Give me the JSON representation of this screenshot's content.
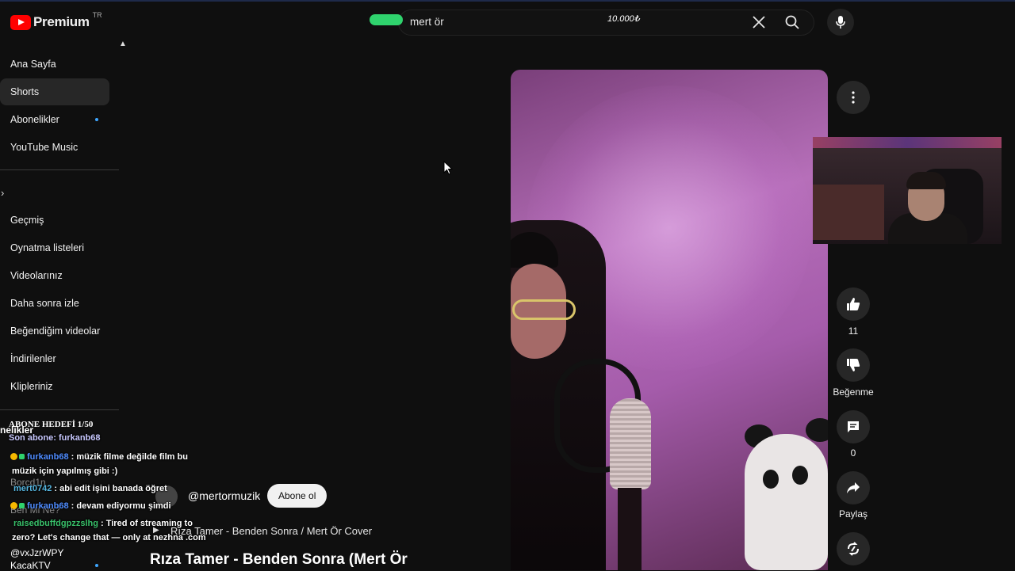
{
  "header": {
    "logo_text": "Premium",
    "country_code": "TR",
    "search": {
      "value": "mert ör",
      "counter_overlay": "10.000₺"
    }
  },
  "sidebar": {
    "items": [
      {
        "label": "Ana Sayfa"
      },
      {
        "label": "Shorts",
        "active": true
      },
      {
        "label": "Abonelikler",
        "has_dot": true
      },
      {
        "label": "YouTube Music"
      }
    ],
    "you_items": [
      {
        "label": "Geçmiş"
      },
      {
        "label": "Oynatma listeleri"
      },
      {
        "label": "Videolarınız"
      },
      {
        "label": "Daha sonra izle"
      },
      {
        "label": "Beğendiğim videolar"
      },
      {
        "label": "İndirilenler"
      },
      {
        "label": "Klipleriniz"
      }
    ],
    "subs_heading_partial": "nelikler",
    "partial_subs": [
      "Borcd1n",
      "Ben Mi Ne?",
      "@vxJzrWPY",
      "KacaKTV"
    ]
  },
  "short": {
    "channel": "@mertormuzik",
    "subscribe_label": "Abone ol",
    "music_line": "Rıza Tamer - Benden Sonra / Mert Ör Cover",
    "title": "Rıza Tamer - Benden Sonra (Mert Ör"
  },
  "actions": {
    "like_count": "11",
    "dislike_label": "Beğenme",
    "comment_count": "0",
    "share_label": "Paylaş"
  },
  "stream_overlay": {
    "goal": "ABONE HEDEFİ 1/50",
    "last_sub": "Son abone: furkanb68",
    "chat": [
      {
        "user": "furkanb68",
        "text": ": müzik filme değilde film bu",
        "text2": "müzik için yapılmış gibi :)"
      },
      {
        "user": "mert0742",
        "text": ": abi edit işini banada öğret"
      },
      {
        "user": "furkanb68",
        "text": ": devam ediyormu şimdi"
      },
      {
        "user": "raisedbuffdgpzzslhg",
        "text": ": Tired of streaming to",
        "text2": "zero? Let's change that — only at nezhna .com"
      }
    ]
  },
  "colors": {
    "accent_green": "#2fd36d",
    "youtube_red": "#ff0000",
    "link_blue": "#3ea6ff"
  }
}
